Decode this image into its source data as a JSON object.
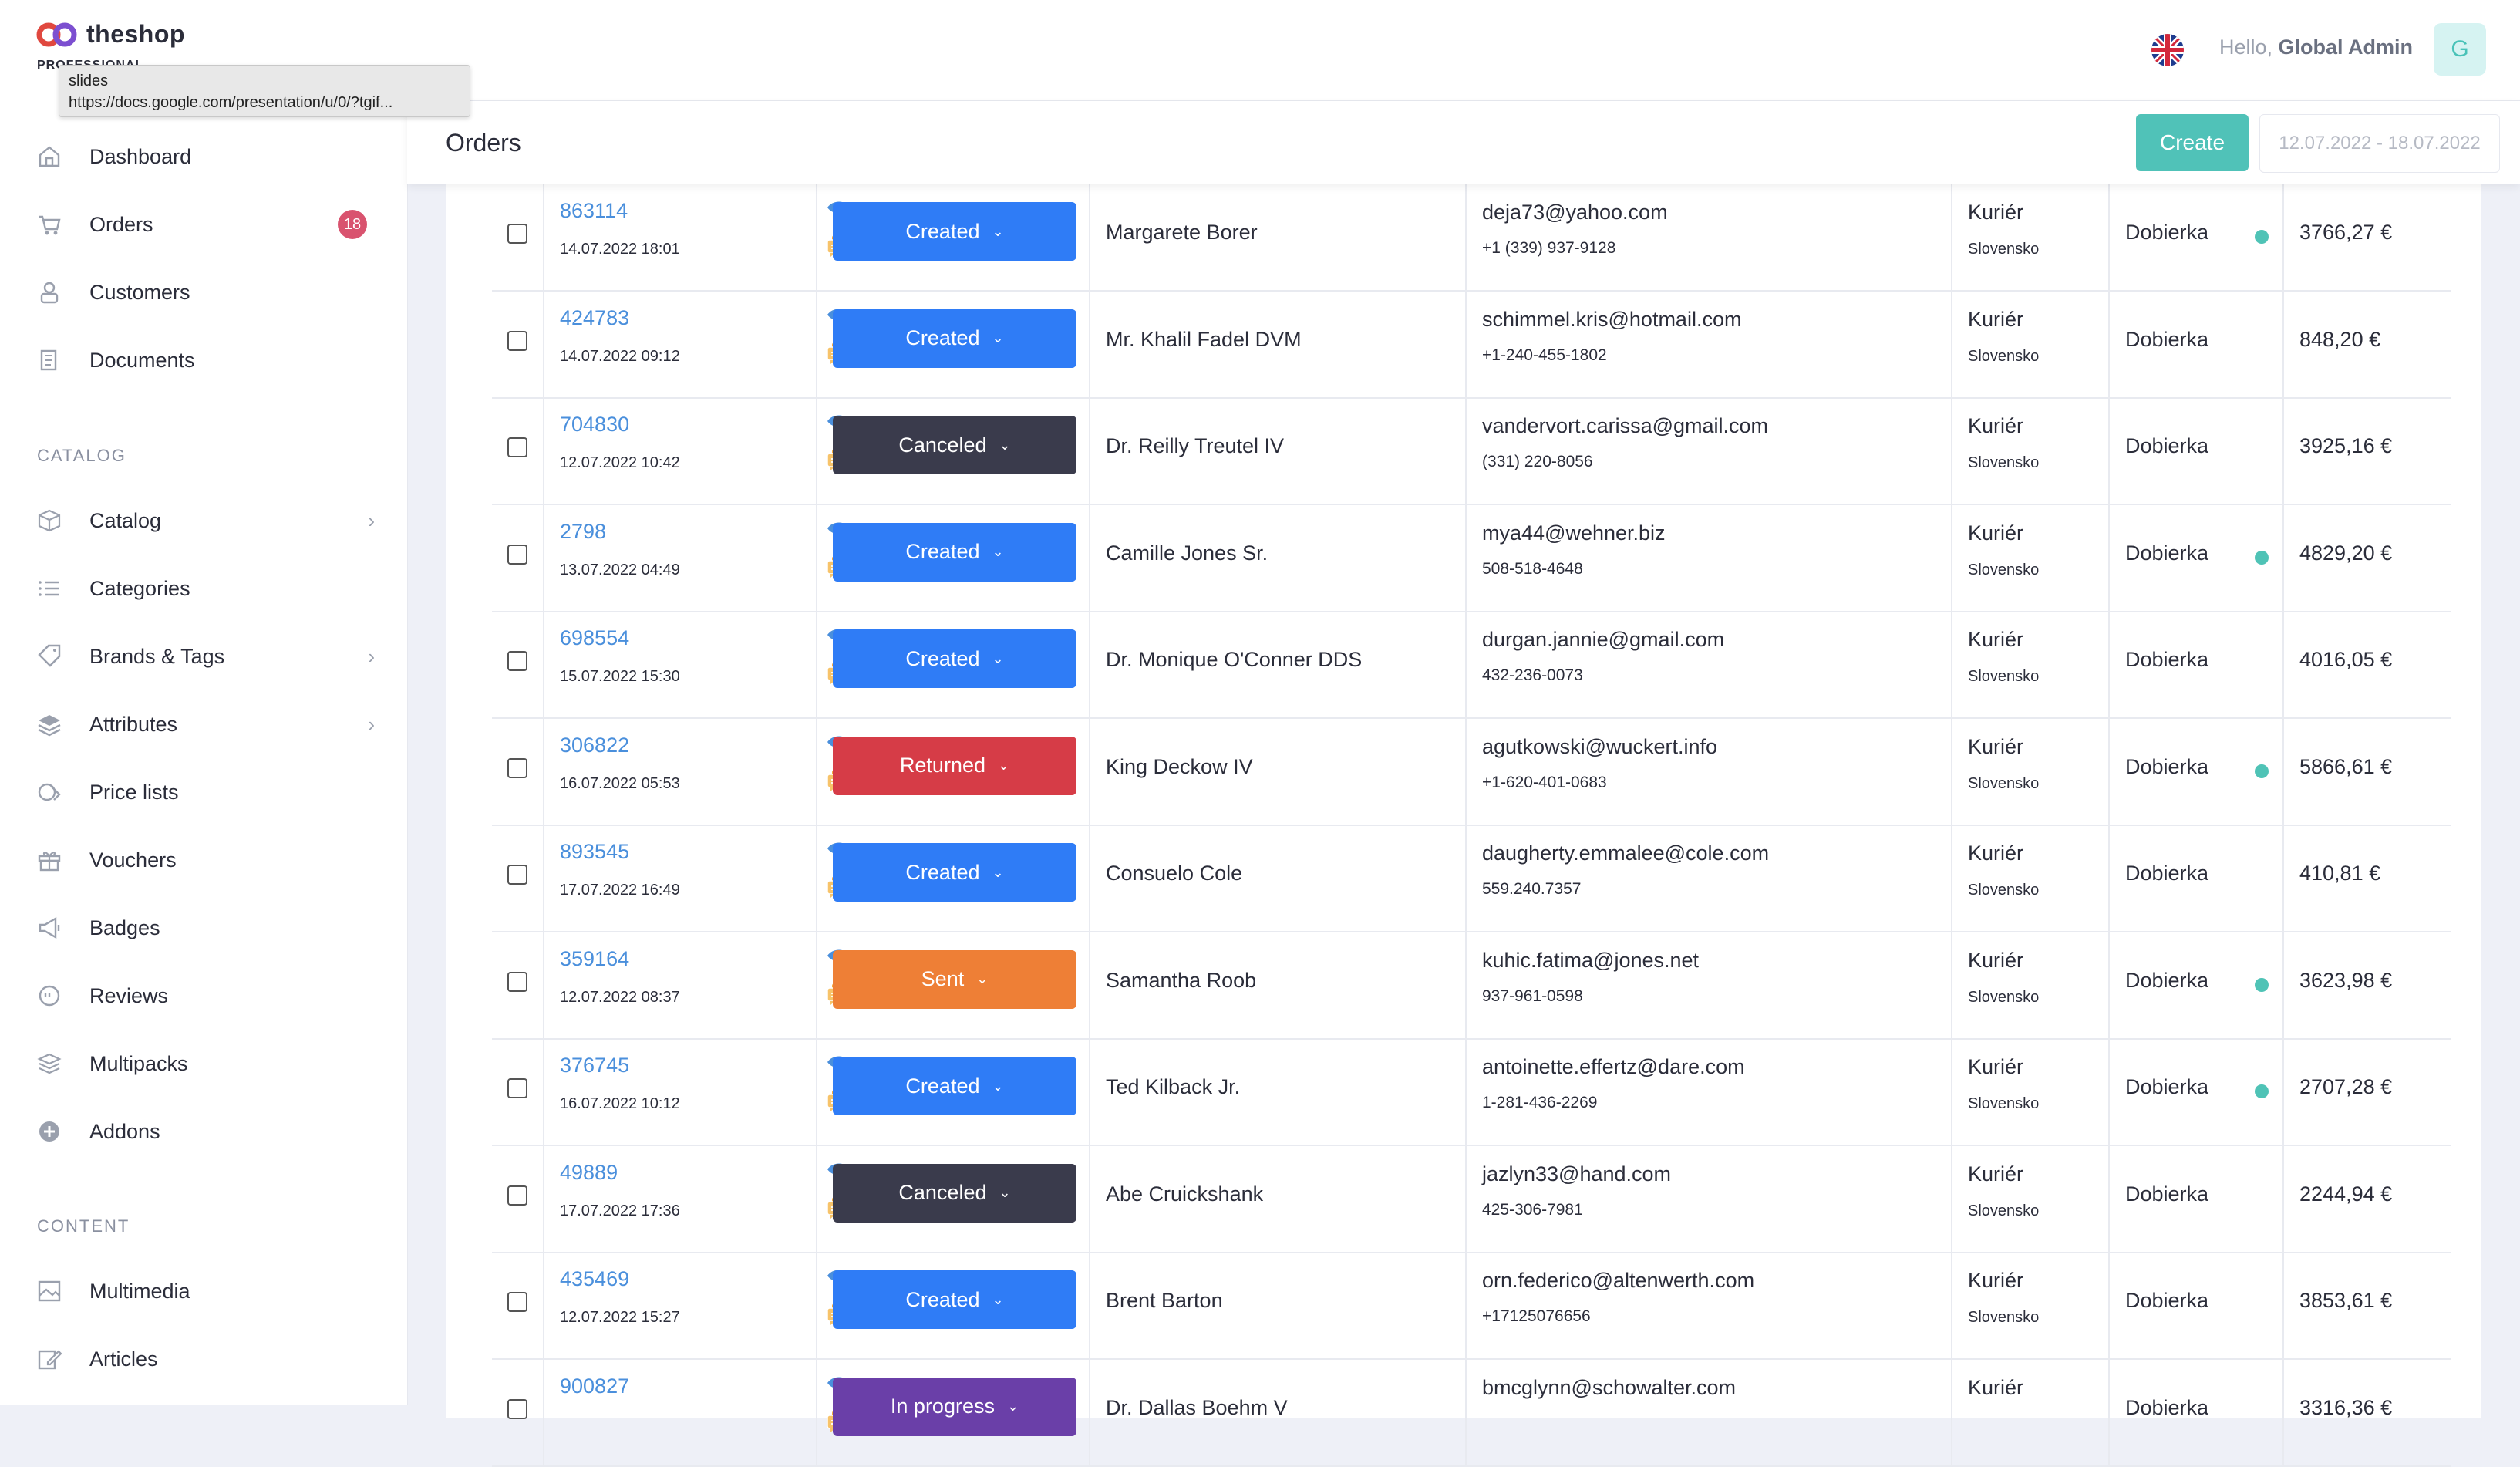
{
  "app": {
    "name": "theshop",
    "edition": "PROFESSIONAL"
  },
  "tooltip": {
    "title": "slides",
    "url": "https://docs.google.com/presentation/u/0/?tgif..."
  },
  "sidebar": {
    "items": [
      {
        "label": "Dashboard",
        "icon": "home-icon"
      },
      {
        "label": "Orders",
        "icon": "cart-icon",
        "badge": "18"
      },
      {
        "label": "Customers",
        "icon": "user-icon"
      },
      {
        "label": "Documents",
        "icon": "documents-icon"
      }
    ],
    "catalog_label": "CATALOG",
    "catalog": [
      {
        "label": "Catalog",
        "icon": "box-icon",
        "chevron": true
      },
      {
        "label": "Categories",
        "icon": "list-icon"
      },
      {
        "label": "Brands & Tags",
        "icon": "tag-icon",
        "chevron": true
      },
      {
        "label": "Attributes",
        "icon": "layers-icon",
        "chevron": true
      },
      {
        "label": "Price lists",
        "icon": "price-icon"
      },
      {
        "label": "Vouchers",
        "icon": "gift-icon"
      },
      {
        "label": "Badges",
        "icon": "megaphone-icon"
      },
      {
        "label": "Reviews",
        "icon": "review-icon"
      },
      {
        "label": "Multipacks",
        "icon": "stack-icon"
      },
      {
        "label": "Addons",
        "icon": "plus-circle-icon"
      }
    ],
    "content_label": "CONTENT",
    "content": [
      {
        "label": "Multimedia",
        "icon": "image-icon"
      },
      {
        "label": "Articles",
        "icon": "edit-icon"
      }
    ]
  },
  "header": {
    "hello": "Hello,",
    "user": "Global Admin",
    "avatar": "G"
  },
  "page": {
    "title": "Orders",
    "create_label": "Create",
    "date_range": "12.07.2022 - 18.07.2022"
  },
  "colors": {
    "created": "#2f7cf6",
    "canceled": "#3a3b4c",
    "returned": "#d63c47",
    "sent": "#ee7f36",
    "in_progress": "#6a3fa8",
    "accent": "#50c2b8"
  },
  "orders": [
    {
      "id": "863114",
      "date": "14.07.2022 18:01",
      "status": "Created",
      "status_key": "created",
      "customer": "Margarete Borer",
      "email": "deja73@yahoo.com",
      "phone": "+1 (339) 937-9128",
      "shipping": "Kuriér",
      "country": "Slovensko",
      "payment": "Dobierka",
      "dot": true,
      "price": "3766,27 €"
    },
    {
      "id": "424783",
      "date": "14.07.2022 09:12",
      "status": "Created",
      "status_key": "created",
      "customer": "Mr. Khalil Fadel DVM",
      "email": "schimmel.kris@hotmail.com",
      "phone": "+1-240-455-1802",
      "shipping": "Kuriér",
      "country": "Slovensko",
      "payment": "Dobierka",
      "dot": false,
      "price": "848,20 €"
    },
    {
      "id": "704830",
      "date": "12.07.2022 10:42",
      "status": "Canceled",
      "status_key": "canceled",
      "customer": "Dr. Reilly Treutel IV",
      "email": "vandervort.carissa@gmail.com",
      "phone": "(331) 220-8056",
      "shipping": "Kuriér",
      "country": "Slovensko",
      "payment": "Dobierka",
      "dot": false,
      "price": "3925,16 €"
    },
    {
      "id": "2798",
      "date": "13.07.2022 04:49",
      "status": "Created",
      "status_key": "created",
      "customer": "Camille Jones Sr.",
      "email": "mya44@wehner.biz",
      "phone": "508-518-4648",
      "shipping": "Kuriér",
      "country": "Slovensko",
      "payment": "Dobierka",
      "dot": true,
      "price": "4829,20 €"
    },
    {
      "id": "698554",
      "date": "15.07.2022 15:30",
      "status": "Created",
      "status_key": "created",
      "customer": "Dr. Monique O'Conner DDS",
      "email": "durgan.jannie@gmail.com",
      "phone": "432-236-0073",
      "shipping": "Kuriér",
      "country": "Slovensko",
      "payment": "Dobierka",
      "dot": false,
      "price": "4016,05 €"
    },
    {
      "id": "306822",
      "date": "16.07.2022 05:53",
      "status": "Returned",
      "status_key": "returned",
      "customer": "King Deckow IV",
      "email": "agutkowski@wuckert.info",
      "phone": "+1-620-401-0683",
      "shipping": "Kuriér",
      "country": "Slovensko",
      "payment": "Dobierka",
      "dot": true,
      "price": "5866,61 €"
    },
    {
      "id": "893545",
      "date": "17.07.2022 16:49",
      "status": "Created",
      "status_key": "created",
      "customer": "Consuelo Cole",
      "email": "daugherty.emmalee@cole.com",
      "phone": "559.240.7357",
      "shipping": "Kuriér",
      "country": "Slovensko",
      "payment": "Dobierka",
      "dot": false,
      "price": "410,81 €"
    },
    {
      "id": "359164",
      "date": "12.07.2022 08:37",
      "status": "Sent",
      "status_key": "sent",
      "customer": "Samantha Roob",
      "email": "kuhic.fatima@jones.net",
      "phone": "937-961-0598",
      "shipping": "Kuriér",
      "country": "Slovensko",
      "payment": "Dobierka",
      "dot": true,
      "price": "3623,98 €"
    },
    {
      "id": "376745",
      "date": "16.07.2022 10:12",
      "status": "Created",
      "status_key": "created",
      "customer": "Ted Kilback Jr.",
      "email": "antoinette.effertz@dare.com",
      "phone": "1-281-436-2269",
      "shipping": "Kuriér",
      "country": "Slovensko",
      "payment": "Dobierka",
      "dot": true,
      "price": "2707,28 €"
    },
    {
      "id": "49889",
      "date": "17.07.2022 17:36",
      "status": "Canceled",
      "status_key": "canceled",
      "customer": "Abe Cruickshank",
      "email": "jazlyn33@hand.com",
      "phone": "425-306-7981",
      "shipping": "Kuriér",
      "country": "Slovensko",
      "payment": "Dobierka",
      "dot": false,
      "price": "2244,94 €"
    },
    {
      "id": "435469",
      "date": "12.07.2022 15:27",
      "status": "Created",
      "status_key": "created",
      "customer": "Brent Barton",
      "email": "orn.federico@altenwerth.com",
      "phone": "+17125076656",
      "shipping": "Kuriér",
      "country": "Slovensko",
      "payment": "Dobierka",
      "dot": false,
      "price": "3853,61 €"
    },
    {
      "id": "900827",
      "date": "",
      "status": "In progress",
      "status_key": "in_progress",
      "customer": "Dr. Dallas Boehm V",
      "email": "bmcglynn@schowalter.com",
      "phone": "",
      "shipping": "Kuriér",
      "country": "",
      "payment": "Dobierka",
      "dot": false,
      "price": "3316,36 €"
    }
  ]
}
